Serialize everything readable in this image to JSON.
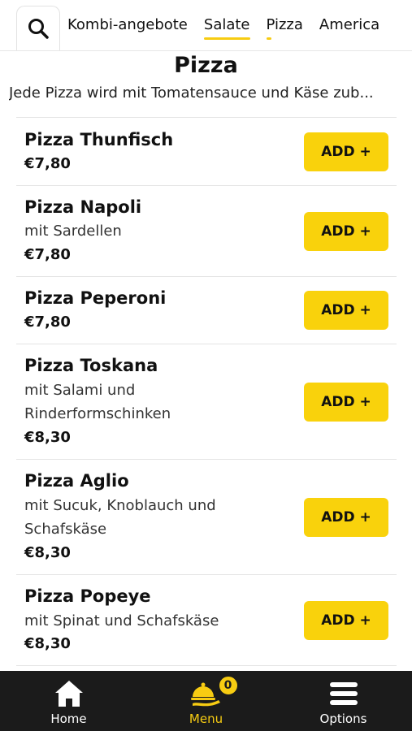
{
  "tabs": [
    {
      "label": "Kombi-angebote"
    },
    {
      "label": "Salate"
    },
    {
      "label": "Pizza"
    },
    {
      "label": "America"
    }
  ],
  "section": {
    "title": "Pizza",
    "description": "Jede Pizza wird mit Tomatensauce und Käse zub..."
  },
  "items": [
    {
      "name": "Pizza Thunfisch",
      "description": "",
      "price": "€7,80",
      "add_label": "ADD +"
    },
    {
      "name": "Pizza Napoli",
      "description": "mit Sardellen",
      "price": "€7,80",
      "add_label": "ADD +"
    },
    {
      "name": "Pizza Peperoni",
      "description": "",
      "price": "€7,80",
      "add_label": "ADD +"
    },
    {
      "name": "Pizza Toskana",
      "description": "mit Salami und Rinderformschinken",
      "price": "€8,30",
      "add_label": "ADD +"
    },
    {
      "name": "Pizza Aglio",
      "description": "mit Sucuk, Knoblauch und Schafskäse",
      "price": "€8,30",
      "add_label": "ADD +"
    },
    {
      "name": "Pizza Popeye",
      "description": "mit Spinat und Schafskäse",
      "price": "€8,30",
      "add_label": "ADD +"
    }
  ],
  "nav": {
    "home": {
      "label": "Home",
      "icon": "home-icon"
    },
    "menu": {
      "label": "Menu",
      "icon": "cloche-icon",
      "badge": "0"
    },
    "options": {
      "label": "Options",
      "icon": "menu-icon"
    }
  },
  "colors": {
    "accent": "#f9d20c",
    "nav_background": "#1b1b1b"
  }
}
